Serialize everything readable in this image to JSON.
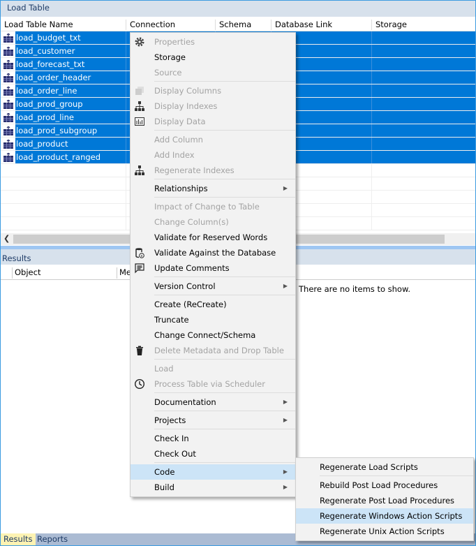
{
  "title": "Load Table",
  "columns": [
    "Load Table Name",
    "Connection",
    "Schema",
    "Database Link",
    "Storage"
  ],
  "rows": [
    "load_budget_txt",
    "load_customer",
    "load_forecast_txt",
    "load_order_header",
    "load_order_line",
    "load_prod_group",
    "load_prod_line",
    "load_prod_subgroup",
    "load_product",
    "load_product_ranged"
  ],
  "results": {
    "title": "Results",
    "columns": [
      "Object",
      "Me"
    ],
    "empty_text": "There are no items to show."
  },
  "tabs": [
    "Results",
    "Reports"
  ],
  "menu": [
    {
      "label": "Properties",
      "disabled": true,
      "icon": "gear"
    },
    {
      "label": "Storage"
    },
    {
      "label": "Source",
      "disabled": true
    },
    {
      "sep": true
    },
    {
      "label": "Display Columns",
      "disabled": true,
      "icon": "columns"
    },
    {
      "label": "Display Indexes",
      "disabled": true,
      "icon": "hierarchy"
    },
    {
      "label": "Display Data",
      "disabled": true,
      "icon": "chart"
    },
    {
      "sep": true
    },
    {
      "label": "Add Column",
      "disabled": true
    },
    {
      "label": "Add Index",
      "disabled": true
    },
    {
      "label": "Regenerate Indexes",
      "disabled": true,
      "icon": "hierarchy"
    },
    {
      "sep": true
    },
    {
      "label": "Relationships",
      "submenu": true
    },
    {
      "sep": true
    },
    {
      "label": "Impact of Change to Table",
      "disabled": true
    },
    {
      "label": "Change Column(s)",
      "disabled": true
    },
    {
      "label": "Validate for Reserved Words"
    },
    {
      "label": "Validate Against the Database",
      "icon": "database-info"
    },
    {
      "label": "Update Comments",
      "icon": "comment"
    },
    {
      "sep": true
    },
    {
      "label": "Version Control",
      "submenu": true
    },
    {
      "sep": true
    },
    {
      "label": "Create (ReCreate)"
    },
    {
      "label": "Truncate"
    },
    {
      "label": "Change Connect/Schema"
    },
    {
      "label": "Delete Metadata and Drop Table",
      "disabled": true,
      "icon": "trash"
    },
    {
      "sep": true
    },
    {
      "label": "Load",
      "disabled": true
    },
    {
      "label": "Process Table via Scheduler",
      "disabled": true,
      "icon": "clock"
    },
    {
      "sep": true
    },
    {
      "label": "Documentation",
      "submenu": true
    },
    {
      "sep": true
    },
    {
      "label": "Projects",
      "submenu": true
    },
    {
      "sep": true
    },
    {
      "label": "Check In"
    },
    {
      "label": "Check Out"
    },
    {
      "sep": true
    },
    {
      "label": "Code",
      "submenu": true,
      "highlighted": true
    },
    {
      "label": "Build",
      "submenu": true
    }
  ],
  "submenu": [
    {
      "label": "Regenerate Load Scripts"
    },
    {
      "sep": true
    },
    {
      "label": "Rebuild Post Load Procedures"
    },
    {
      "label": "Regenerate Post Load Procedures"
    },
    {
      "label": "Regenerate Windows Action Scripts",
      "highlighted": true
    },
    {
      "label": "Regenerate Unix Action Scripts"
    }
  ],
  "colors": {
    "selection": "#0078d7",
    "menu_highlight": "#cce4f7",
    "title_bg": "#d7e1ec",
    "active_tab": "#fdf3b3"
  }
}
